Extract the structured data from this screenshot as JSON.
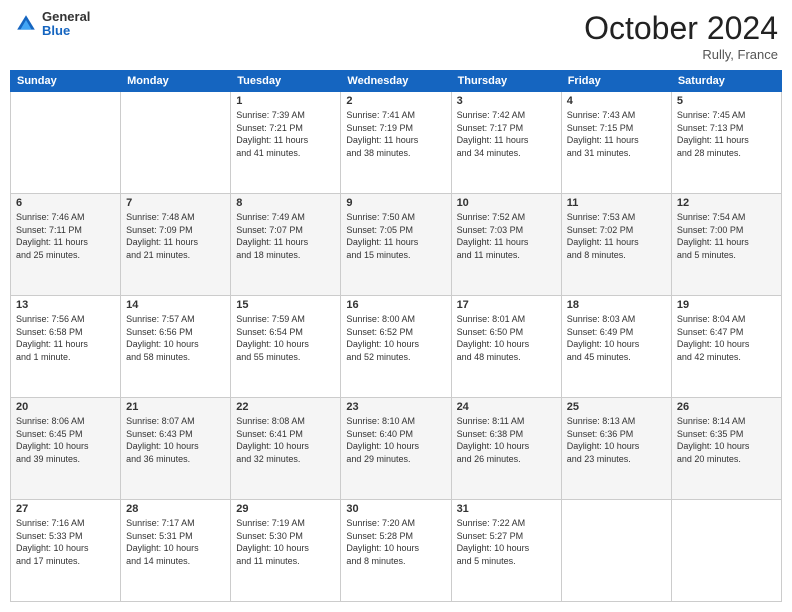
{
  "header": {
    "logo_general": "General",
    "logo_blue": "Blue",
    "month_title": "October 2024",
    "location": "Rully, France"
  },
  "days_of_week": [
    "Sunday",
    "Monday",
    "Tuesday",
    "Wednesday",
    "Thursday",
    "Friday",
    "Saturday"
  ],
  "weeks": [
    [
      {
        "day": "",
        "info": ""
      },
      {
        "day": "",
        "info": ""
      },
      {
        "day": "1",
        "info": "Sunrise: 7:39 AM\nSunset: 7:21 PM\nDaylight: 11 hours\nand 41 minutes."
      },
      {
        "day": "2",
        "info": "Sunrise: 7:41 AM\nSunset: 7:19 PM\nDaylight: 11 hours\nand 38 minutes."
      },
      {
        "day": "3",
        "info": "Sunrise: 7:42 AM\nSunset: 7:17 PM\nDaylight: 11 hours\nand 34 minutes."
      },
      {
        "day": "4",
        "info": "Sunrise: 7:43 AM\nSunset: 7:15 PM\nDaylight: 11 hours\nand 31 minutes."
      },
      {
        "day": "5",
        "info": "Sunrise: 7:45 AM\nSunset: 7:13 PM\nDaylight: 11 hours\nand 28 minutes."
      }
    ],
    [
      {
        "day": "6",
        "info": "Sunrise: 7:46 AM\nSunset: 7:11 PM\nDaylight: 11 hours\nand 25 minutes."
      },
      {
        "day": "7",
        "info": "Sunrise: 7:48 AM\nSunset: 7:09 PM\nDaylight: 11 hours\nand 21 minutes."
      },
      {
        "day": "8",
        "info": "Sunrise: 7:49 AM\nSunset: 7:07 PM\nDaylight: 11 hours\nand 18 minutes."
      },
      {
        "day": "9",
        "info": "Sunrise: 7:50 AM\nSunset: 7:05 PM\nDaylight: 11 hours\nand 15 minutes."
      },
      {
        "day": "10",
        "info": "Sunrise: 7:52 AM\nSunset: 7:03 PM\nDaylight: 11 hours\nand 11 minutes."
      },
      {
        "day": "11",
        "info": "Sunrise: 7:53 AM\nSunset: 7:02 PM\nDaylight: 11 hours\nand 8 minutes."
      },
      {
        "day": "12",
        "info": "Sunrise: 7:54 AM\nSunset: 7:00 PM\nDaylight: 11 hours\nand 5 minutes."
      }
    ],
    [
      {
        "day": "13",
        "info": "Sunrise: 7:56 AM\nSunset: 6:58 PM\nDaylight: 11 hours\nand 1 minute."
      },
      {
        "day": "14",
        "info": "Sunrise: 7:57 AM\nSunset: 6:56 PM\nDaylight: 10 hours\nand 58 minutes."
      },
      {
        "day": "15",
        "info": "Sunrise: 7:59 AM\nSunset: 6:54 PM\nDaylight: 10 hours\nand 55 minutes."
      },
      {
        "day": "16",
        "info": "Sunrise: 8:00 AM\nSunset: 6:52 PM\nDaylight: 10 hours\nand 52 minutes."
      },
      {
        "day": "17",
        "info": "Sunrise: 8:01 AM\nSunset: 6:50 PM\nDaylight: 10 hours\nand 48 minutes."
      },
      {
        "day": "18",
        "info": "Sunrise: 8:03 AM\nSunset: 6:49 PM\nDaylight: 10 hours\nand 45 minutes."
      },
      {
        "day": "19",
        "info": "Sunrise: 8:04 AM\nSunset: 6:47 PM\nDaylight: 10 hours\nand 42 minutes."
      }
    ],
    [
      {
        "day": "20",
        "info": "Sunrise: 8:06 AM\nSunset: 6:45 PM\nDaylight: 10 hours\nand 39 minutes."
      },
      {
        "day": "21",
        "info": "Sunrise: 8:07 AM\nSunset: 6:43 PM\nDaylight: 10 hours\nand 36 minutes."
      },
      {
        "day": "22",
        "info": "Sunrise: 8:08 AM\nSunset: 6:41 PM\nDaylight: 10 hours\nand 32 minutes."
      },
      {
        "day": "23",
        "info": "Sunrise: 8:10 AM\nSunset: 6:40 PM\nDaylight: 10 hours\nand 29 minutes."
      },
      {
        "day": "24",
        "info": "Sunrise: 8:11 AM\nSunset: 6:38 PM\nDaylight: 10 hours\nand 26 minutes."
      },
      {
        "day": "25",
        "info": "Sunrise: 8:13 AM\nSunset: 6:36 PM\nDaylight: 10 hours\nand 23 minutes."
      },
      {
        "day": "26",
        "info": "Sunrise: 8:14 AM\nSunset: 6:35 PM\nDaylight: 10 hours\nand 20 minutes."
      }
    ],
    [
      {
        "day": "27",
        "info": "Sunrise: 7:16 AM\nSunset: 5:33 PM\nDaylight: 10 hours\nand 17 minutes."
      },
      {
        "day": "28",
        "info": "Sunrise: 7:17 AM\nSunset: 5:31 PM\nDaylight: 10 hours\nand 14 minutes."
      },
      {
        "day": "29",
        "info": "Sunrise: 7:19 AM\nSunset: 5:30 PM\nDaylight: 10 hours\nand 11 minutes."
      },
      {
        "day": "30",
        "info": "Sunrise: 7:20 AM\nSunset: 5:28 PM\nDaylight: 10 hours\nand 8 minutes."
      },
      {
        "day": "31",
        "info": "Sunrise: 7:22 AM\nSunset: 5:27 PM\nDaylight: 10 hours\nand 5 minutes."
      },
      {
        "day": "",
        "info": ""
      },
      {
        "day": "",
        "info": ""
      }
    ]
  ]
}
